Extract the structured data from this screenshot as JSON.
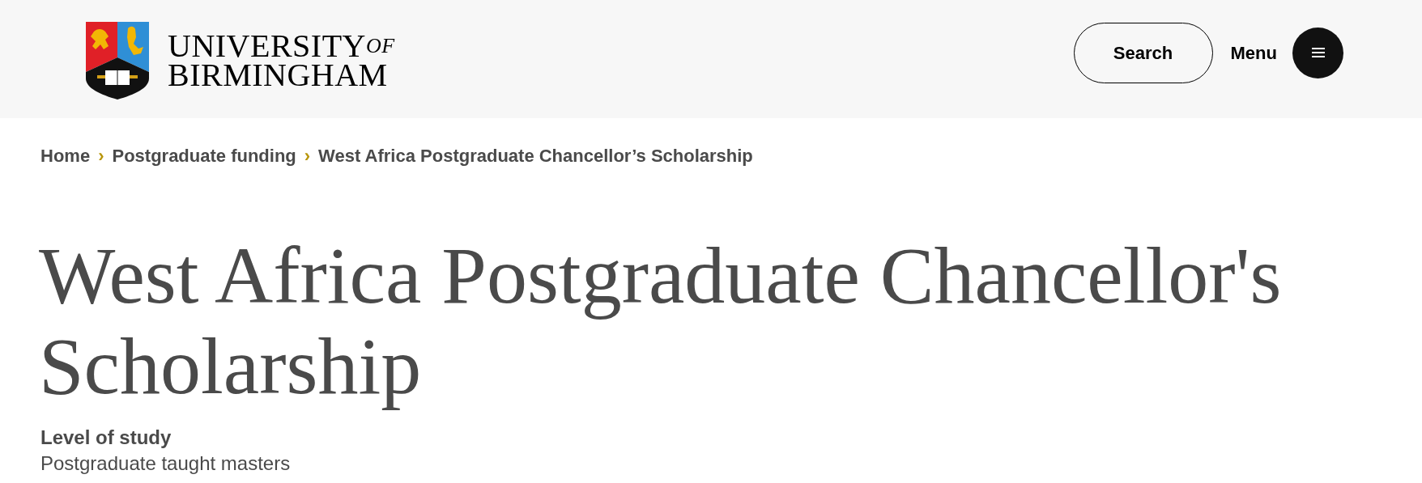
{
  "header": {
    "logo": {
      "line1": "UNIVERSITY",
      "of": "OF",
      "line2": "BIRMINGHAM"
    },
    "search_button": "Search",
    "menu_label": "Menu"
  },
  "breadcrumb": [
    {
      "label": "Home"
    },
    {
      "label": "Postgraduate funding"
    },
    {
      "label": "West Africa Postgraduate Chancellor’s Scholarship"
    }
  ],
  "separator": "›",
  "title": "West Africa Postgraduate Chancellor's Scholarship",
  "details": [
    {
      "label": "Level of study",
      "value": "Postgraduate taught masters"
    }
  ]
}
